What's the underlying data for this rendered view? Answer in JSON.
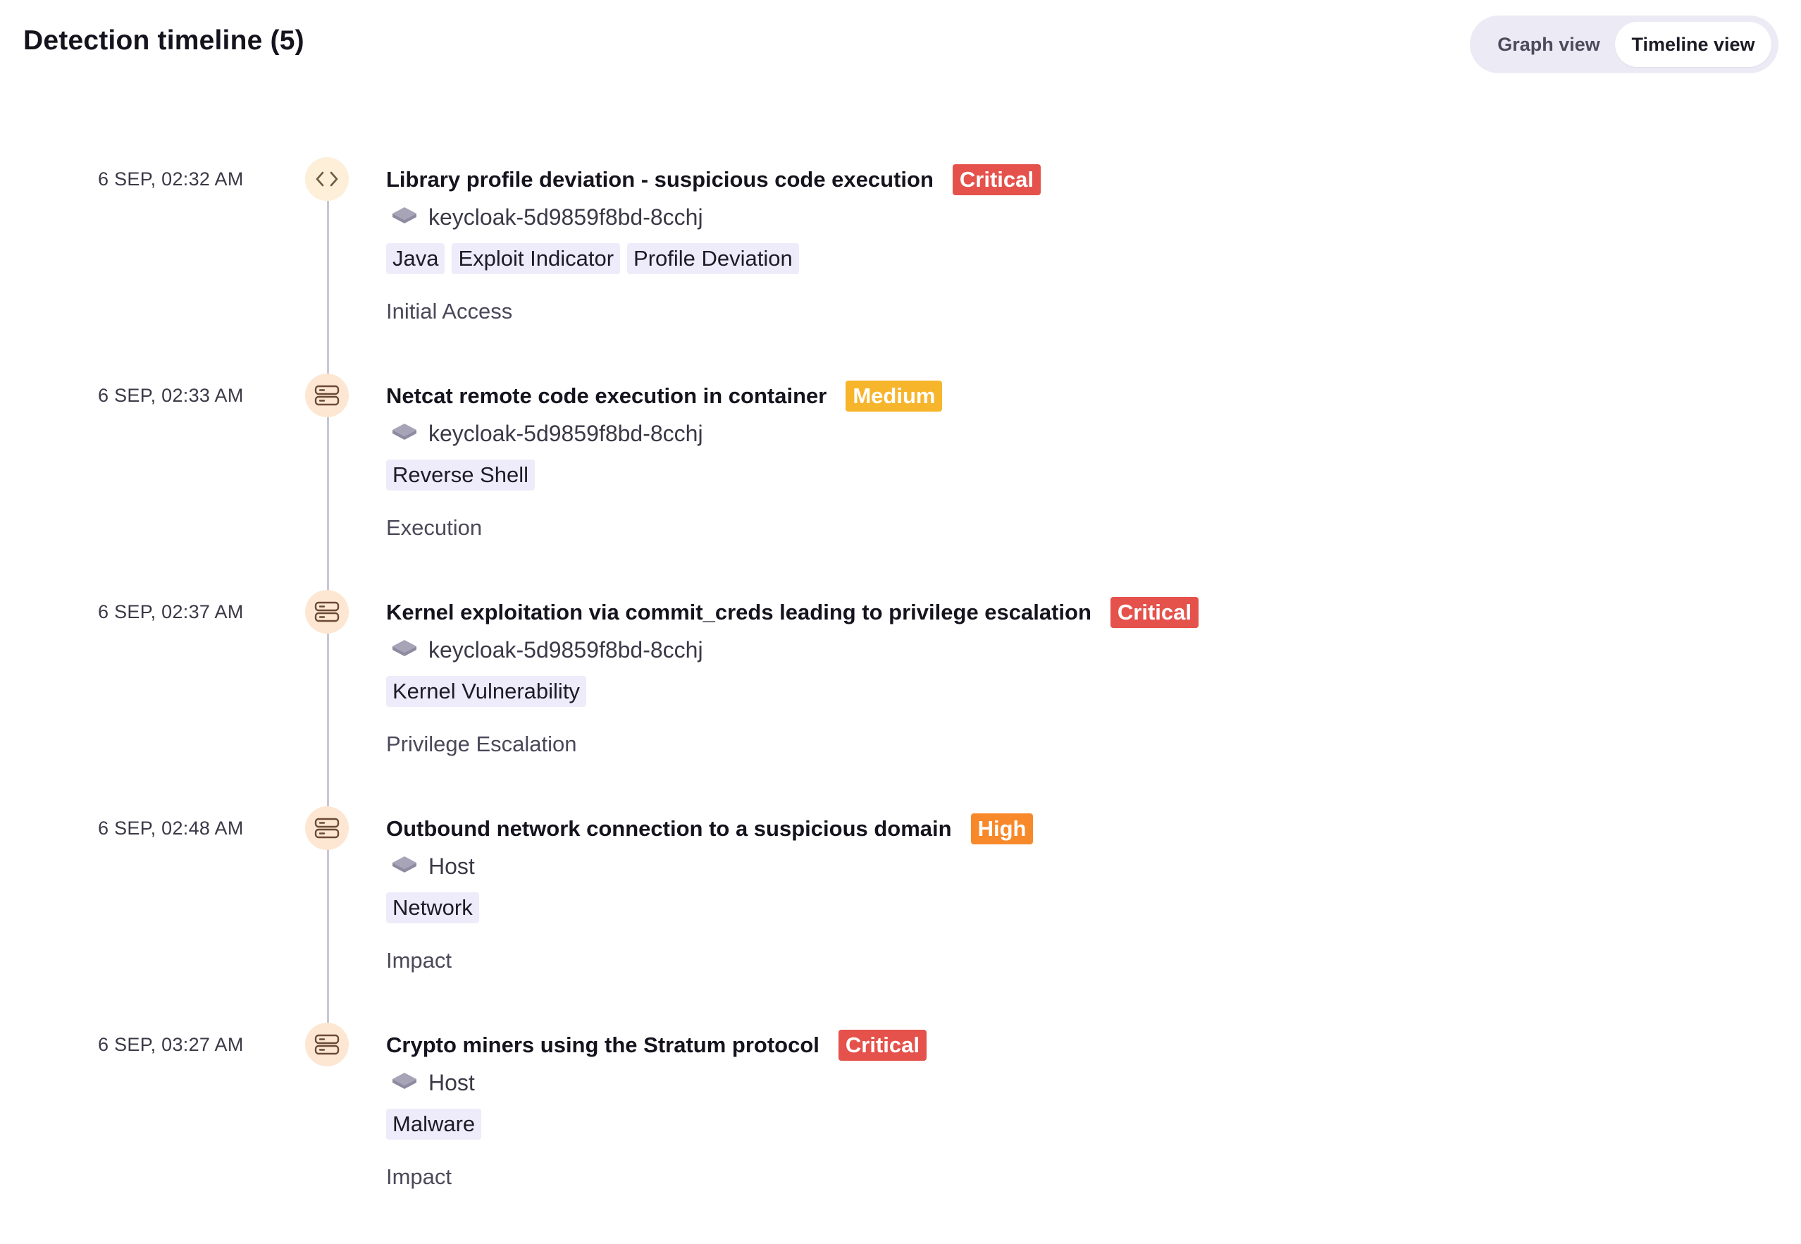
{
  "header": {
    "title": "Detection timeline",
    "count": "(5)"
  },
  "view_toggle": {
    "graph_label": "Graph view",
    "timeline_label": "Timeline view",
    "selected": "Timeline view"
  },
  "colors": {
    "critical": "#e5514b",
    "medium": "#f7b52c",
    "high": "#f7892b",
    "node_bg": "#fde7d3",
    "tag_bg": "#eeecfa"
  },
  "events": [
    {
      "time": "6 SEP, 02:32 AM",
      "icon": "code-icon",
      "title": "Library profile deviation - suspicious code execution",
      "severity": "Critical",
      "resource": "keycloak-5d9859f8bd-8cchj",
      "resource_icon": "layer-icon",
      "tags": [
        "Java",
        "Exploit Indicator",
        "Profile Deviation"
      ],
      "phase": "Initial Access"
    },
    {
      "time": "6 SEP, 02:33 AM",
      "icon": "server-icon",
      "title": "Netcat remote code execution in container",
      "severity": "Medium",
      "resource": "keycloak-5d9859f8bd-8cchj",
      "resource_icon": "layer-icon",
      "tags": [
        "Reverse Shell"
      ],
      "phase": "Execution"
    },
    {
      "time": "6 SEP, 02:37 AM",
      "icon": "server-icon",
      "title": "Kernel exploitation via commit_creds leading to privilege escalation",
      "severity": "Critical",
      "resource": "keycloak-5d9859f8bd-8cchj",
      "resource_icon": "layer-icon",
      "tags": [
        "Kernel Vulnerability"
      ],
      "phase": "Privilege Escalation"
    },
    {
      "time": "6 SEP, 02:48 AM",
      "icon": "server-icon",
      "title": "Outbound network connection to a suspicious domain",
      "severity": "High",
      "resource": "Host",
      "resource_icon": "layer-icon",
      "tags": [
        "Network"
      ],
      "phase": "Impact"
    },
    {
      "time": "6 SEP, 03:27 AM",
      "icon": "server-icon",
      "title": "Crypto miners using the Stratum protocol",
      "severity": "Critical",
      "resource": "Host",
      "resource_icon": "layer-icon",
      "tags": [
        "Malware"
      ],
      "phase": "Impact"
    }
  ]
}
